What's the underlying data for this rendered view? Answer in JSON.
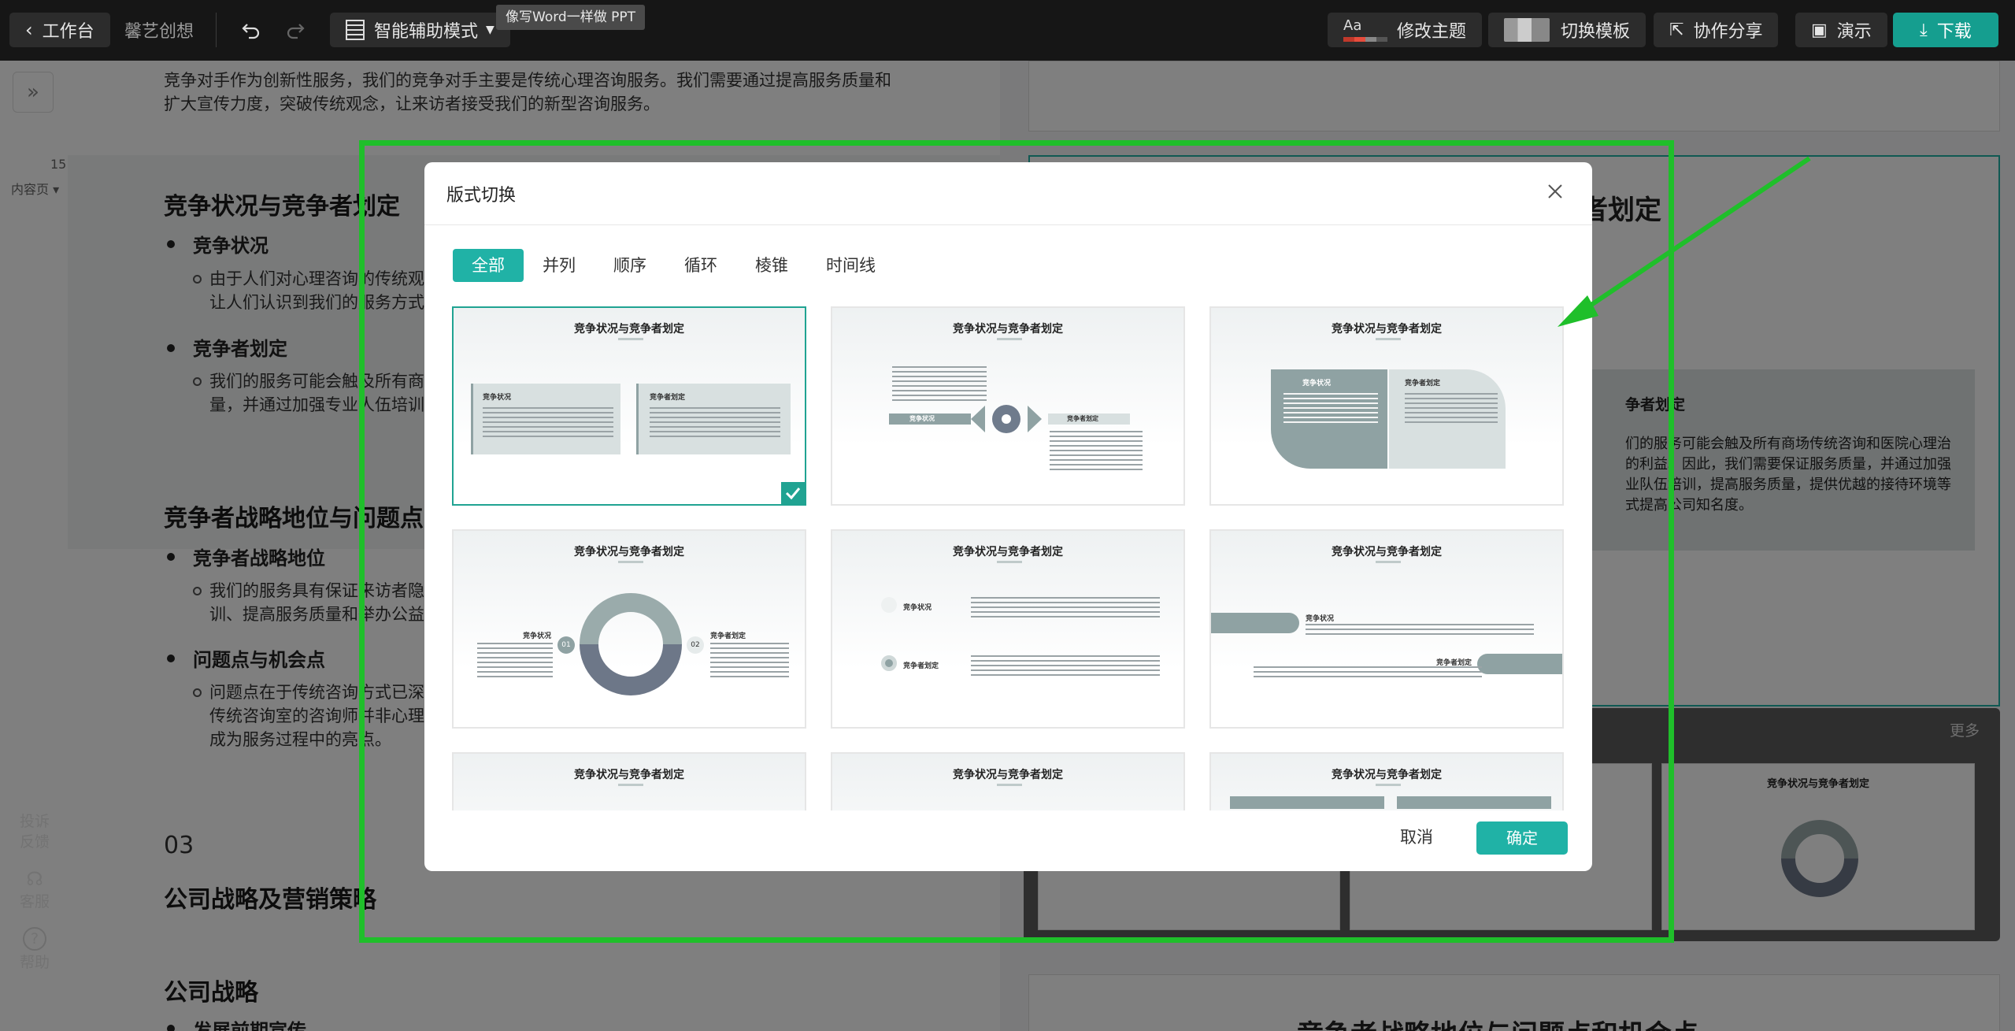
{
  "topbar": {
    "back_label": "工作台",
    "doc_title": "馨艺创想",
    "mode_label": "智能辅助模式",
    "mode_tooltip": "像写Word一样做 PPT",
    "theme_aa": "Aa",
    "theme_label": "修改主题",
    "template_label": "切换模板",
    "share_label": "协作分享",
    "present_label": "演示",
    "download_label": "下载",
    "brand_color": "#159e8f"
  },
  "editor": {
    "intro": "竞争对手作为创新性服务，我们的竞争对手主要是传统心理咨询服务。我们需要通过提高服务质量和扩大宣传力度，突破传统观念，让来访者接受我们的新型咨询服务。",
    "page_number": "15",
    "page_type": "内容页",
    "h_competition": "竞争状况与竞争者划定",
    "b_status": "竞争状况",
    "status_text": "由于人们对心理咨询的传统观",
    "status_text2": "让人们认识到我们的服务方式",
    "b_define": "竞争者划定",
    "define_text": "我们的服务可能会触及所有商",
    "define_text2": "量，并通过加强专业人伍培训",
    "h_strategy": "竞争者战略地位与问题点",
    "b_strategy": "竞争者战略地位",
    "strategy_text": "我们的服务具有保证来访者隐",
    "strategy_text2": "训、提高服务质量和举办公益",
    "b_problem": "问题点与机会点",
    "problem_text": "问题点在于传统咨询方式已深",
    "problem_text2": "传统咨询室的咨询师并非心理",
    "problem_text3": "成为服务过程中的亮点。",
    "section_num": "03",
    "h_company": "公司战略及营销策略",
    "h_company_strategy": "公司战略",
    "b_early": "发展前期宣传"
  },
  "left_tools": {
    "feedback": "投诉反馈",
    "service": "客服",
    "help": "帮助"
  },
  "right_panel": {
    "slide_title_partial": "者划定",
    "slide_sub": "争者划定",
    "slide_text1": "们的服务可能会触及所有商场传统咨询和医院心理治",
    "slide_text2": "的利益。因此，我们需要保证服务质量，并通过加强",
    "slide_text3": "业队伍培训，提高服务质量，提供优越的接待环境等",
    "slide_text4": "式提高公司知名度。",
    "more_label": "更多",
    "next_slide_title": "竞争者战略地位与问题点和机会点"
  },
  "modal": {
    "title": "版式切换",
    "tabs": [
      "全部",
      "并列",
      "顺序",
      "循环",
      "棱锥",
      "时间线"
    ],
    "active_tab": 0,
    "thumb_title": "竞争状况与竞争者划定",
    "label_status": "竞争状况",
    "label_define": "竞争者划定",
    "num_01": "01",
    "num_02": "02",
    "cancel_label": "取消",
    "ok_label": "确定",
    "accent_color": "#20b2a6"
  }
}
